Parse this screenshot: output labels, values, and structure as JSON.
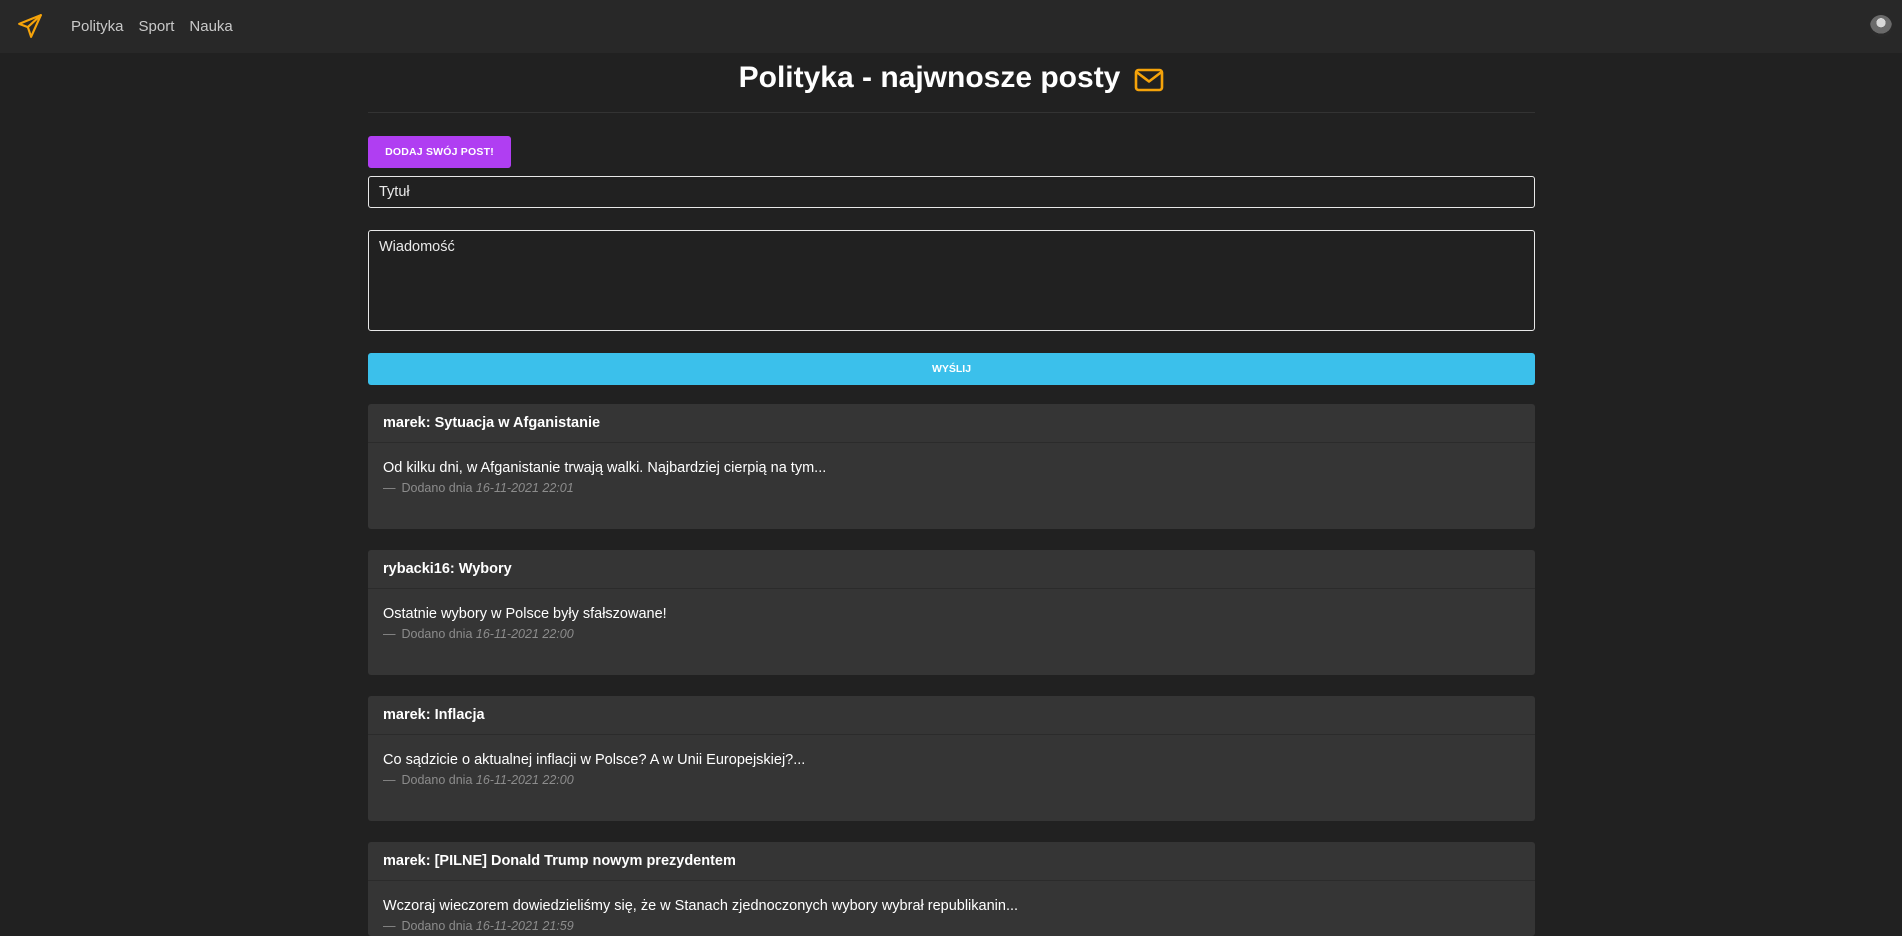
{
  "nav": {
    "items": [
      "Polityka",
      "Sport",
      "Nauka"
    ]
  },
  "header": {
    "title": "Polityka - najwnosze posty"
  },
  "form": {
    "add_button": "DODAJ SWÓJ POST!",
    "title_placeholder": "Tytuł",
    "message_placeholder": "Wiadomość",
    "send_button": "WYŚLIJ"
  },
  "posts": [
    {
      "author": "marek",
      "title": "Sytuacja w Afganistanie",
      "heading": "marek: Sytuacja w Afganistanie",
      "text": "Od kilku dni, w Afganistanie trwają walki. Najbardziej cierpią na tym...",
      "added_label": "Dodano dnia",
      "date": "16-11-2021 22:01"
    },
    {
      "author": "rybacki16",
      "title": "Wybory",
      "heading": "rybacki16: Wybory",
      "text": "Ostatnie wybory w Polsce były sfałszowane!",
      "added_label": "Dodano dnia",
      "date": "16-11-2021 22:00"
    },
    {
      "author": "marek",
      "title": "Inflacja",
      "heading": "marek: Inflacja",
      "text": "Co sądzicie o aktualnej inflacji w Polsce? A w Unii Europejskiej?...",
      "added_label": "Dodano dnia",
      "date": "16-11-2021 22:00"
    },
    {
      "author": "marek",
      "title": "[PILNE] Donald Trump nowym prezydentem",
      "heading": "marek: [PILNE] Donald Trump nowym prezydentem",
      "text": "Wczoraj wieczorem dowiedzieliśmy się, że w Stanach zjednoczonych wybory wybrał republikanin...",
      "added_label": "Dodano dnia",
      "date": "16-11-2021 21:59"
    }
  ],
  "colors": {
    "accent_orange": "#f5a30a",
    "add_button": "#b03ef2",
    "send_button": "#3bc0eb",
    "background": "#212121",
    "card": "#353535"
  },
  "icons": {
    "brand": "paper-plane-icon",
    "title": "envelope-icon",
    "user": "avatar"
  }
}
